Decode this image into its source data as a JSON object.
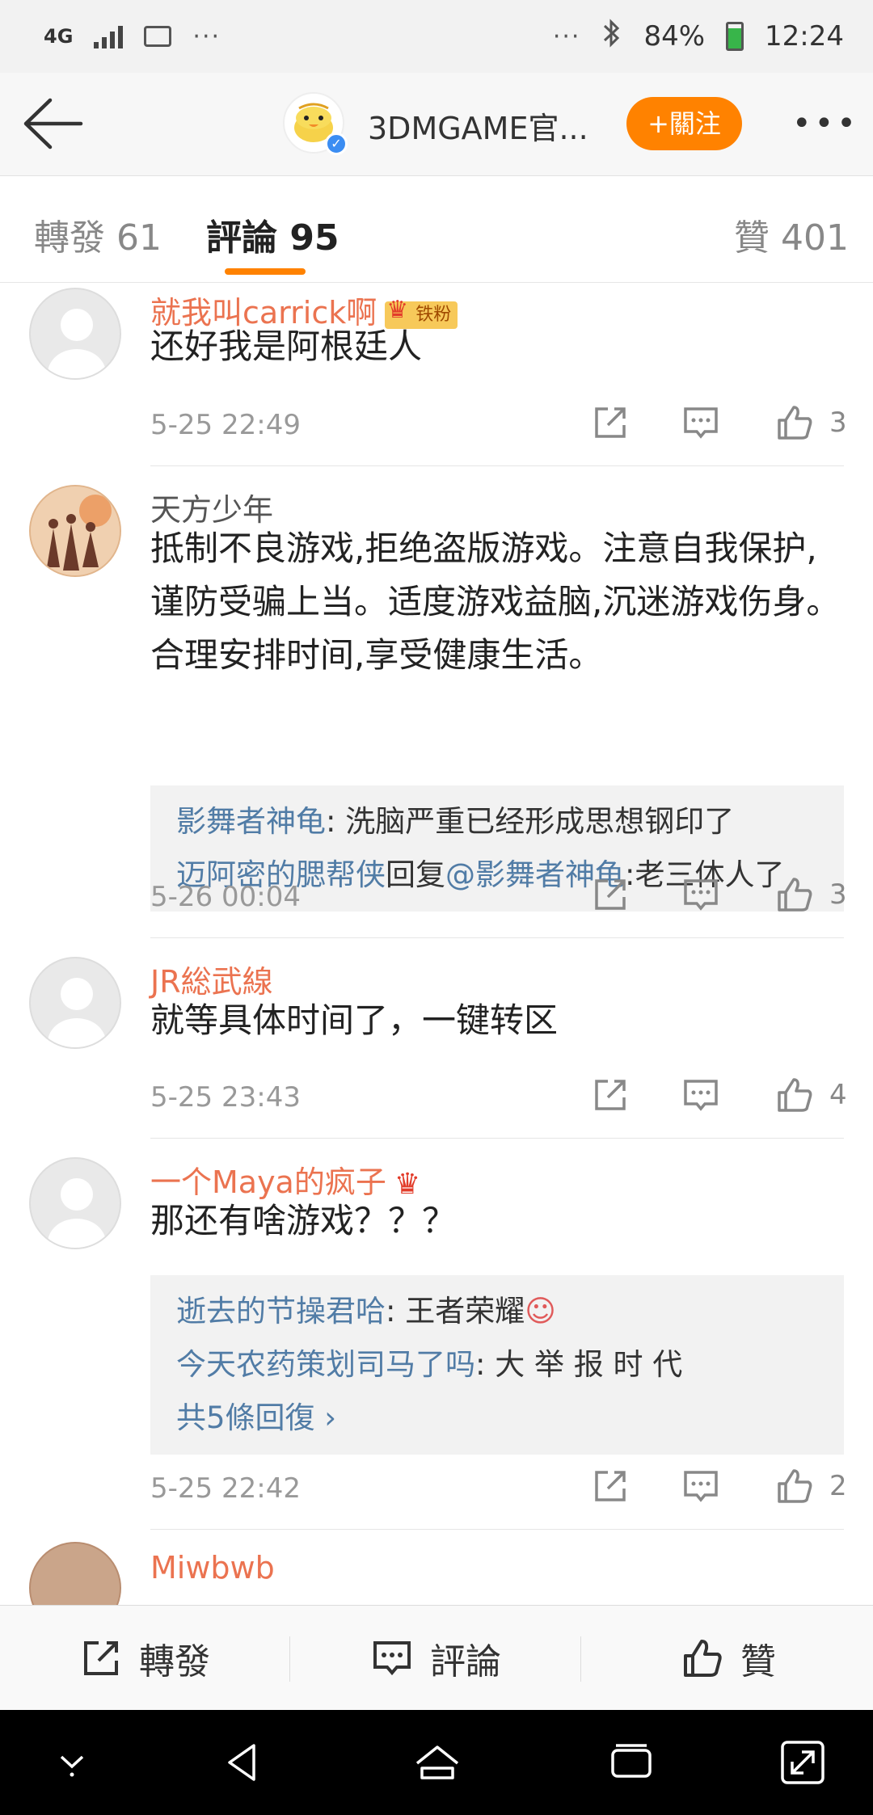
{
  "status_bar": {
    "network": "4G",
    "overflow": "···",
    "right_overflow": "···",
    "battery": "84%",
    "time": "12:24"
  },
  "header": {
    "title": "3DMGAME官...",
    "follow_label": "+關注",
    "more_label": "•••"
  },
  "tabs": {
    "repost": "轉發 61",
    "comments": "評論 95",
    "likes": "贊 401"
  },
  "comments": [
    {
      "name": "就我叫carrick啊",
      "badge": "铁粉",
      "text": "还好我是阿根廷人",
      "time": "5-25 22:49",
      "likes": "3"
    },
    {
      "name": "天方少年",
      "text": "抵制不良游戏,拒绝盗版游戏。注意自我保护,谨防受骗上当。适度游戏益脑,沉迷游戏伤身。合理安排时间,享受健康生活。",
      "replies": [
        {
          "user": "影舞者神龟",
          "sep": ": ",
          "text": "洗脑严重已经形成思想钢印了"
        },
        {
          "user": "迈阿密的腮帮侠",
          "mid": "回复",
          "mention": "@影舞者神龟",
          "sep": ":",
          "text": "老三体人了"
        }
      ],
      "time": "5-26 00:04",
      "likes": "3"
    },
    {
      "name": "JR総武線",
      "text": "就等具体时间了，一键转区",
      "time": "5-25 23:43",
      "likes": "4"
    },
    {
      "name": "一个Maya的疯子",
      "text": "那还有啥游戏？？？",
      "replies": [
        {
          "user": "逝去的节操君哈",
          "sep": ": ",
          "text": "王者荣耀"
        },
        {
          "user": "今天农药策划司马了吗",
          "sep": ": ",
          "text": "大 举 报 时 代"
        }
      ],
      "more_replies": "共5條回復 ›",
      "time": "5-25 22:42",
      "likes": "2"
    },
    {
      "name": "Miwbwb"
    }
  ],
  "bottom_bar": {
    "repost": "轉發",
    "comment": "評論",
    "like": "贊"
  },
  "colors": {
    "accent": "#ff8200",
    "username": "#eb7350",
    "reply_user": "#517ca6"
  }
}
